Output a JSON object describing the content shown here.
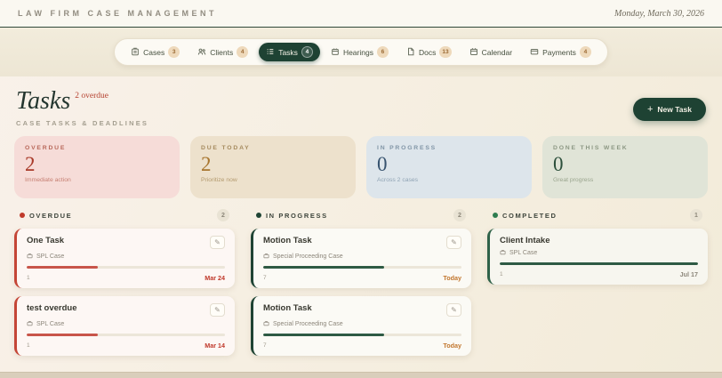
{
  "header": {
    "app_title": "LAW FIRM CASE MANAGEMENT",
    "date": "Monday, March 30, 2026"
  },
  "nav": {
    "tabs": [
      {
        "label": "Cases",
        "badge": "3",
        "icon": "cases-icon"
      },
      {
        "label": "Clients",
        "badge": "4",
        "icon": "clients-icon"
      },
      {
        "label": "Tasks",
        "badge": "4",
        "icon": "tasks-icon",
        "active": true
      },
      {
        "label": "Hearings",
        "badge": "6",
        "icon": "hearings-icon"
      },
      {
        "label": "Docs",
        "badge": "13",
        "icon": "docs-icon"
      },
      {
        "label": "Calendar",
        "badge": "",
        "icon": "calendar-icon"
      },
      {
        "label": "Payments",
        "badge": "4",
        "icon": "payments-icon"
      }
    ]
  },
  "page": {
    "title": "Tasks",
    "overdue_note": "2 overdue",
    "subtitle": "CASE TASKS & DEADLINES",
    "new_task_label": "New Task",
    "accent_green": "#1e4233",
    "accent_red": "#b5402f"
  },
  "stats": [
    {
      "label": "OVERDUE",
      "value": "2",
      "caption": "Immediate action",
      "accent": "#a93b2a"
    },
    {
      "label": "DUE TODAY",
      "value": "2",
      "caption": "Prioritize now",
      "accent": "#a8762f"
    },
    {
      "label": "IN PROGRESS",
      "value": "0",
      "caption": "Across 2 cases",
      "accent": "#37536f"
    },
    {
      "label": "DONE THIS WEEK",
      "value": "0",
      "caption": "Great progress",
      "accent": "#2c4f3b"
    }
  ],
  "board": {
    "columns": [
      {
        "label": "OVERDUE",
        "count": "2",
        "dot_color": "#c0392b",
        "cards": [
          {
            "title": "One Task",
            "case": "SPL Case",
            "progress_pct": 36,
            "progress_style": "width:36%",
            "subtask_count": "1",
            "due": "Mar 24"
          },
          {
            "title": "test overdue",
            "case": "SPL Case",
            "progress_pct": 36,
            "progress_style": "width:36%",
            "subtask_count": "1",
            "due": "Mar 14"
          }
        ]
      },
      {
        "label": "IN PROGRESS",
        "count": "2",
        "dot_color": "#1f4434",
        "cards": [
          {
            "title": "Motion Task",
            "case": "Special Proceeding Case",
            "progress_pct": 61,
            "progress_style": "width:61%",
            "subtask_count": "7",
            "due": "Today"
          },
          {
            "title": "Motion Task",
            "case": "Special Proceeding Case",
            "progress_pct": 61,
            "progress_style": "width:61%",
            "subtask_count": "7",
            "due": "Today"
          }
        ]
      },
      {
        "label": "COMPLETED",
        "count": "1",
        "dot_color": "#2e7d4f",
        "cards": [
          {
            "title": "Client Intake",
            "case": "SPL Case",
            "progress_pct": 100,
            "progress_style": "width:100%",
            "subtask_count": "1",
            "due": "Jul 17"
          }
        ]
      }
    ]
  }
}
